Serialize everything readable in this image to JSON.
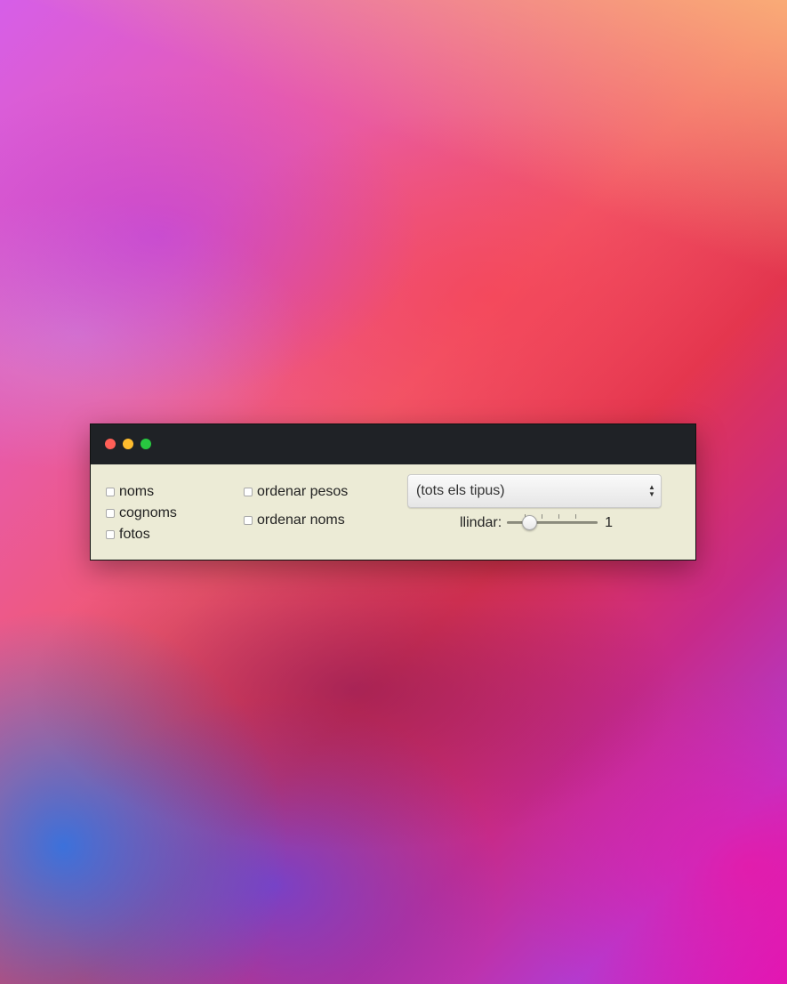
{
  "window": {
    "controls": {
      "close": "close-icon",
      "minimize": "minimize-icon",
      "maximize": "maximize-icon"
    }
  },
  "options": {
    "col1": [
      {
        "label": "noms",
        "checked": false
      },
      {
        "label": "cognoms",
        "checked": false
      },
      {
        "label": "fotos",
        "checked": false
      }
    ],
    "col2": [
      {
        "label": "ordenar pesos",
        "checked": false
      },
      {
        "label": "ordenar noms",
        "checked": false
      }
    ]
  },
  "type_select": {
    "value": "(tots els tipus)",
    "arrows_icon": "up-down-arrows-icon"
  },
  "threshold": {
    "label": "llindar:",
    "value": "1",
    "slider_fraction": 0.2
  },
  "colors": {
    "titlebar": "#1f2226",
    "panel": "#ecebd6",
    "close": "#ff5f57",
    "minimize": "#febc2e",
    "maximize": "#28c840"
  }
}
